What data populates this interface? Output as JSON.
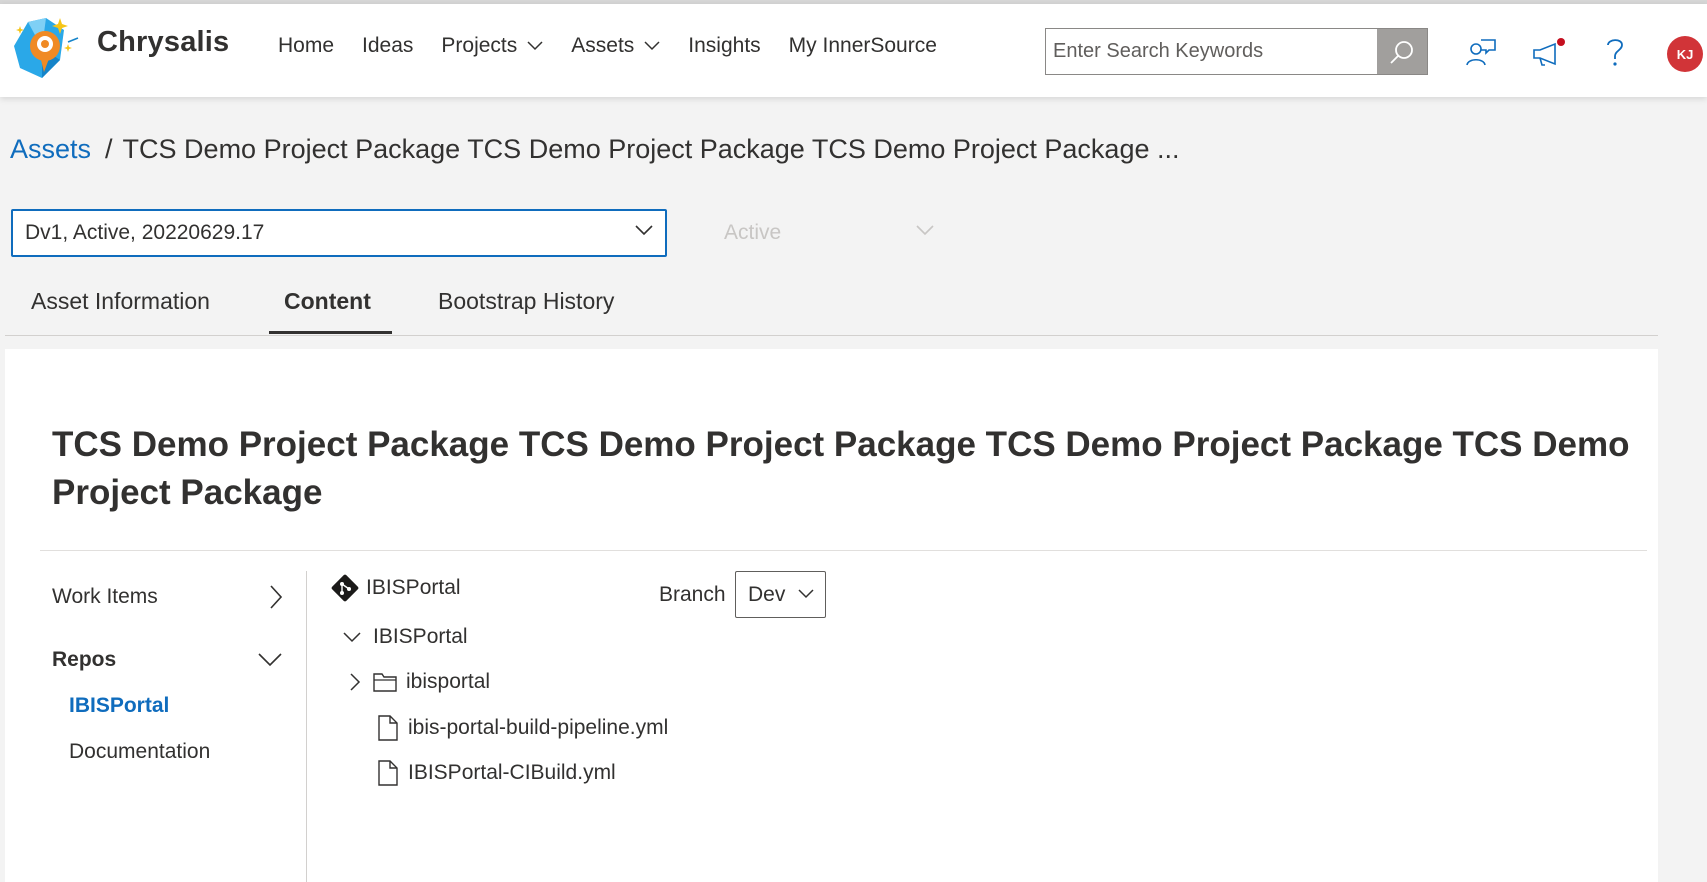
{
  "header": {
    "brand": "Chrysalis",
    "nav": [
      {
        "label": "Home",
        "has_dropdown": false
      },
      {
        "label": "Ideas",
        "has_dropdown": false
      },
      {
        "label": "Projects",
        "has_dropdown": true
      },
      {
        "label": "Assets",
        "has_dropdown": true
      },
      {
        "label": "Insights",
        "has_dropdown": false
      },
      {
        "label": "My InnerSource",
        "has_dropdown": false
      }
    ],
    "search_placeholder": "Enter Search Keywords",
    "icons": [
      "search-icon",
      "feedback-icon",
      "announcement-icon",
      "help-icon"
    ],
    "avatar_initials": "KJ",
    "colors": {
      "accent": "#0f6cbd",
      "avatar": "#d13438",
      "notification_dot": "#c50f1f"
    }
  },
  "breadcrumb": {
    "root": "Assets",
    "separator": "/",
    "current": "TCS Demo Project Package TCS Demo Project Package TCS Demo Project Package ..."
  },
  "version_select": {
    "value": "Dv1, Active, 20220629.17"
  },
  "status_select": {
    "value": "Active",
    "disabled": true
  },
  "tabs": [
    {
      "label": "Asset Information",
      "active": false
    },
    {
      "label": "Content",
      "active": true
    },
    {
      "label": "Bootstrap History",
      "active": false
    }
  ],
  "content": {
    "title": "TCS Demo Project Package TCS Demo Project Package TCS Demo Project Package TCS Demo Project Package",
    "sidebar": {
      "work_items": "Work Items",
      "repos": "Repos",
      "repo_items": [
        {
          "label": "IBISPortal",
          "selected": true
        },
        {
          "label": "Documentation",
          "selected": false
        }
      ]
    },
    "repo": {
      "name": "IBISPortal",
      "branch_label": "Branch",
      "branch_value": "Dev",
      "tree_root": "IBISPortal",
      "tree": [
        {
          "type": "folder",
          "name": "ibisportal",
          "expanded": false
        },
        {
          "type": "file",
          "name": "ibis-portal-build-pipeline.yml"
        },
        {
          "type": "file",
          "name": "IBISPortal-CIBuild.yml"
        }
      ]
    }
  }
}
